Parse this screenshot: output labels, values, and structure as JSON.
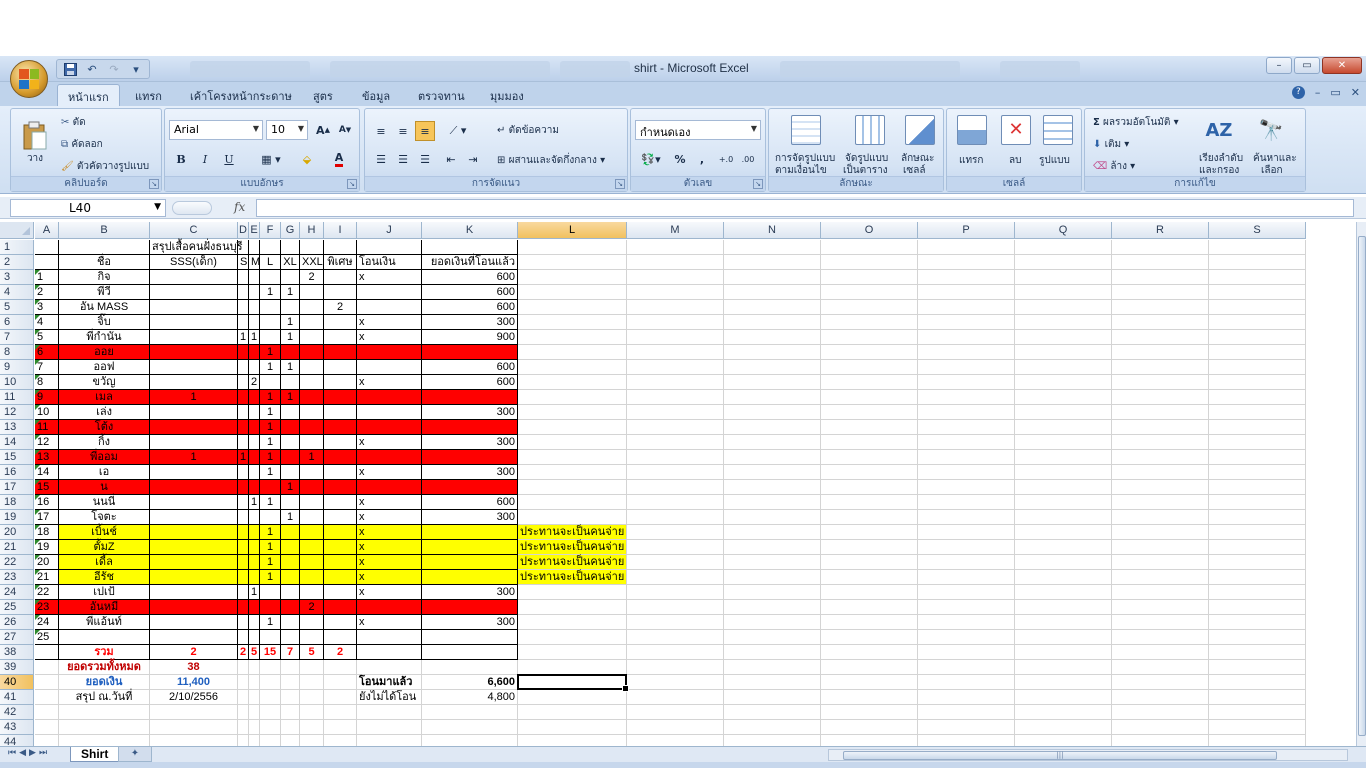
{
  "app": {
    "title": "shirt - Microsoft Excel",
    "tabs": [
      "หน้าแรก",
      "แทรก",
      "เค้าโครงหน้ากระดาษ",
      "สูตร",
      "ข้อมูล",
      "ตรวจทาน",
      "มุมมอง"
    ],
    "active_tab": "หน้าแรก",
    "help_icon": "?",
    "window_buttons": {
      "minimize": "–",
      "maximize": "▭",
      "close": "✕"
    }
  },
  "ribbon": {
    "clipboard": {
      "label": "คลิปบอร์ด",
      "paste": "วาง",
      "cut": "ตัด",
      "copy": "คัดลอก",
      "format_painter": "ตัวคัดวางรูปแบบ"
    },
    "font": {
      "label": "แบบอักษร",
      "name": "Arial",
      "size": "10",
      "bold": "B",
      "italic": "I",
      "underline": "U"
    },
    "alignment": {
      "label": "การจัดแนว",
      "wrap": "ตัดข้อความ",
      "merge": "ผสานและจัดกึ่งกลาง"
    },
    "number": {
      "label": "ตัวเลข",
      "format": "กำหนดเอง",
      "percent": "%",
      "comma": ","
    },
    "styles": {
      "label": "ลักษณะ",
      "conditional": "การจัดรูปแบบ",
      "conditional2": "ตามเงื่อนไข",
      "table": "จัดรูปแบบ",
      "table2": "เป็นตาราง",
      "cell": "ลักษณะ",
      "cell2": "เซลล์"
    },
    "cells": {
      "label": "เซลล์",
      "insert": "แทรก",
      "delete": "ลบ",
      "format": "รูปแบบ"
    },
    "editing": {
      "label": "การแก้ไข",
      "autosum": "ผลรวมอัตโนมัติ",
      "fill": "เติม",
      "clear": "ล้าง",
      "sort": "เรียงลำดับ",
      "sort2": "และกรอง",
      "find": "ค้นหาและ",
      "find2": "เลือก"
    }
  },
  "formula_bar": {
    "name_box": "L40",
    "fx": "fx",
    "value": ""
  },
  "columns": [
    "A",
    "B",
    "C",
    "D",
    "E",
    "F",
    "G",
    "H",
    "I",
    "J",
    "K",
    "L",
    "M",
    "N",
    "O",
    "P",
    "Q",
    "R",
    "S"
  ],
  "selected_column": "L",
  "selected_row": "40",
  "rows": [
    {
      "n": "1",
      "style": "",
      "a": "",
      "b": "",
      "c": "สรุปเสื้อคนฝั่งธนบุรี",
      "d": "",
      "e": "",
      "f": "",
      "g": "",
      "h": "",
      "i": "",
      "j": "",
      "k": "",
      "l": ""
    },
    {
      "n": "2",
      "style": "",
      "a": "",
      "b": "ชื่อ",
      "c": "SSS(เด็ก)",
      "d": "S",
      "e": "M",
      "f": "L",
      "g": "XL",
      "h": "XXL",
      "i": "พิเศษ",
      "j": "โอนเงิน",
      "k": "ยอดเงินที่โอนแล้ว",
      "l": ""
    },
    {
      "n": "3",
      "style": "",
      "a": "1",
      "b": "กิจ",
      "c": "",
      "d": "",
      "e": "",
      "f": "",
      "g": "",
      "h": "2",
      "i": "",
      "j": "x",
      "k": "600",
      "l": ""
    },
    {
      "n": "4",
      "style": "",
      "a": "2",
      "b": "พีวี",
      "c": "",
      "d": "",
      "e": "",
      "f": "1",
      "g": "1",
      "h": "",
      "i": "",
      "j": "",
      "k": "600",
      "l": ""
    },
    {
      "n": "5",
      "style": "",
      "a": "3",
      "b": "อัน MASS",
      "c": "",
      "d": "",
      "e": "",
      "f": "",
      "g": "",
      "h": "",
      "i": "2",
      "j": "",
      "k": "600",
      "l": ""
    },
    {
      "n": "6",
      "style": "",
      "a": "4",
      "b": "จิ๊บ",
      "c": "",
      "d": "",
      "e": "",
      "f": "",
      "g": "1",
      "h": "",
      "i": "",
      "j": "x",
      "k": "300",
      "l": ""
    },
    {
      "n": "7",
      "style": "",
      "a": "5",
      "b": "พี่กำนัน",
      "c": "",
      "d": "1",
      "e": "1",
      "f": "",
      "g": "1",
      "h": "",
      "i": "",
      "j": "x",
      "k": "900",
      "l": ""
    },
    {
      "n": "8",
      "style": "red",
      "a": "6",
      "b": "ออย",
      "c": "",
      "d": "",
      "e": "",
      "f": "1",
      "g": "",
      "h": "",
      "i": "",
      "j": "",
      "k": "",
      "l": ""
    },
    {
      "n": "9",
      "style": "",
      "a": "7",
      "b": "ออฟ",
      "c": "",
      "d": "",
      "e": "",
      "f": "1",
      "g": "1",
      "h": "",
      "i": "",
      "j": "",
      "k": "600",
      "l": ""
    },
    {
      "n": "10",
      "style": "",
      "a": "8",
      "b": "ขวัญ",
      "c": "",
      "d": "",
      "e": "2",
      "f": "",
      "g": "",
      "h": "",
      "i": "",
      "j": "x",
      "k": "600",
      "l": ""
    },
    {
      "n": "11",
      "style": "red",
      "a": "9",
      "b": "เมล",
      "c": "1",
      "d": "",
      "e": "",
      "f": "1",
      "g": "1",
      "h": "",
      "i": "",
      "j": "",
      "k": "",
      "l": ""
    },
    {
      "n": "12",
      "style": "",
      "a": "10",
      "b": "เล่ง",
      "c": "",
      "d": "",
      "e": "",
      "f": "1",
      "g": "",
      "h": "",
      "i": "",
      "j": "",
      "k": "300",
      "l": ""
    },
    {
      "n": "13",
      "style": "red",
      "a": "11",
      "b": "โต้ง",
      "c": "",
      "d": "",
      "e": "",
      "f": "1",
      "g": "",
      "h": "",
      "i": "",
      "j": "",
      "k": "",
      "l": ""
    },
    {
      "n": "14",
      "style": "",
      "a": "12",
      "b": "กิ้ง",
      "c": "",
      "d": "",
      "e": "",
      "f": "1",
      "g": "",
      "h": "",
      "i": "",
      "j": "x",
      "k": "300",
      "l": ""
    },
    {
      "n": "15",
      "style": "red",
      "a": "13",
      "b": "พี่ออม",
      "c": "1",
      "d": "1",
      "e": "",
      "f": "1",
      "g": "",
      "h": "1",
      "i": "",
      "j": "",
      "k": "",
      "l": ""
    },
    {
      "n": "16",
      "style": "",
      "a": "14",
      "b": "เอ",
      "c": "",
      "d": "",
      "e": "",
      "f": "1",
      "g": "",
      "h": "",
      "i": "",
      "j": "x",
      "k": "300",
      "l": ""
    },
    {
      "n": "17",
      "style": "red",
      "a": "15",
      "b": "น",
      "c": "",
      "d": "",
      "e": "",
      "f": "",
      "g": "1",
      "h": "",
      "i": "",
      "j": "",
      "k": "",
      "l": ""
    },
    {
      "n": "18",
      "style": "",
      "a": "16",
      "b": "นนนี่",
      "c": "",
      "d": "",
      "e": "1",
      "f": "1",
      "g": "",
      "h": "",
      "i": "",
      "j": "x",
      "k": "600",
      "l": ""
    },
    {
      "n": "19",
      "style": "",
      "a": "17",
      "b": "โจตะ",
      "c": "",
      "d": "",
      "e": "",
      "f": "",
      "g": "1",
      "h": "",
      "i": "",
      "j": "x",
      "k": "300",
      "l": ""
    },
    {
      "n": "20",
      "style": "yel",
      "a": "18",
      "b": "เบิ้นช์",
      "c": "",
      "d": "",
      "e": "",
      "f": "1",
      "g": "",
      "h": "",
      "i": "",
      "j": "x",
      "k": "",
      "l": "ประทานจะเป็นคนจ่าย"
    },
    {
      "n": "21",
      "style": "yel",
      "a": "19",
      "b": "ตั้มZ",
      "c": "",
      "d": "",
      "e": "",
      "f": "1",
      "g": "",
      "h": "",
      "i": "",
      "j": "x",
      "k": "",
      "l": "ประทานจะเป็นคนจ่าย"
    },
    {
      "n": "22",
      "style": "yel",
      "a": "20",
      "b": "เดี้ล",
      "c": "",
      "d": "",
      "e": "",
      "f": "1",
      "g": "",
      "h": "",
      "i": "",
      "j": "x",
      "k": "",
      "l": "ประทานจะเป็นคนจ่าย"
    },
    {
      "n": "23",
      "style": "yel",
      "a": "21",
      "b": "อีรัช",
      "c": "",
      "d": "",
      "e": "",
      "f": "1",
      "g": "",
      "h": "",
      "i": "",
      "j": "x",
      "k": "",
      "l": "ประทานจะเป็นคนจ่าย"
    },
    {
      "n": "24",
      "style": "",
      "a": "22",
      "b": "เปเป้",
      "c": "",
      "d": "",
      "e": "1",
      "f": "",
      "g": "",
      "h": "",
      "i": "",
      "j": "x",
      "k": "300",
      "l": ""
    },
    {
      "n": "25",
      "style": "red",
      "a": "23",
      "b": "อันหมี",
      "c": "",
      "d": "",
      "e": "",
      "f": "",
      "g": "",
      "h": "2",
      "i": "",
      "j": "",
      "k": "",
      "l": ""
    },
    {
      "n": "26",
      "style": "",
      "a": "24",
      "b": "พี่แอ้นท์",
      "c": "",
      "d": "",
      "e": "",
      "f": "1",
      "g": "",
      "h": "",
      "i": "",
      "j": "x",
      "k": "300",
      "l": ""
    },
    {
      "n": "27",
      "style": "",
      "a": "25",
      "b": "",
      "c": "",
      "d": "",
      "e": "",
      "f": "",
      "g": "",
      "h": "",
      "i": "",
      "j": "",
      "k": "",
      "l": ""
    },
    {
      "n": "38",
      "style": "total",
      "a": "",
      "b": "รวม",
      "c": "2",
      "d": "2",
      "e": "5",
      "f": "15",
      "g": "7",
      "h": "5",
      "i": "2",
      "j": "",
      "k": "",
      "l": ""
    },
    {
      "n": "39",
      "style": "grand",
      "a": "",
      "b": "ยอดรวมทั้งหมด",
      "c": "38",
      "d": "",
      "e": "",
      "f": "",
      "g": "",
      "h": "",
      "i": "",
      "j": "",
      "k": "",
      "l": ""
    },
    {
      "n": "40",
      "style": "money",
      "a": "",
      "b": "ยอดเงิน",
      "c": "11,400",
      "d": "",
      "e": "",
      "f": "",
      "g": "",
      "h": "",
      "i": "",
      "j": "โอนมาแล้ว",
      "k": "6,600",
      "l": ""
    },
    {
      "n": "41",
      "style": "plain",
      "a": "",
      "b": "สรุป ณ.วันที่",
      "c": "2/10/2556",
      "d": "",
      "e": "",
      "f": "",
      "g": "",
      "h": "",
      "i": "",
      "j": "ยังไม่ได้โอน",
      "k": "4,800",
      "l": ""
    },
    {
      "n": "42",
      "style": "plain",
      "a": "",
      "b": "",
      "c": "",
      "d": "",
      "e": "",
      "f": "",
      "g": "",
      "h": "",
      "i": "",
      "j": "",
      "k": "",
      "l": ""
    },
    {
      "n": "43",
      "style": "plain",
      "a": "",
      "b": "",
      "c": "",
      "d": "",
      "e": "",
      "f": "",
      "g": "",
      "h": "",
      "i": "",
      "j": "",
      "k": "",
      "l": ""
    },
    {
      "n": "44",
      "style": "plain",
      "a": "",
      "b": "",
      "c": "",
      "d": "",
      "e": "",
      "f": "",
      "g": "",
      "h": "",
      "i": "",
      "j": "",
      "k": "",
      "l": ""
    }
  ],
  "sheet_tabs": [
    "Shirt"
  ],
  "colors": {
    "red_fill": "#ff0000",
    "yellow_fill": "#ffff00",
    "total_text": "#ff0000",
    "money_text": "#1f5fbf",
    "selection_header": "#f1c15f"
  }
}
